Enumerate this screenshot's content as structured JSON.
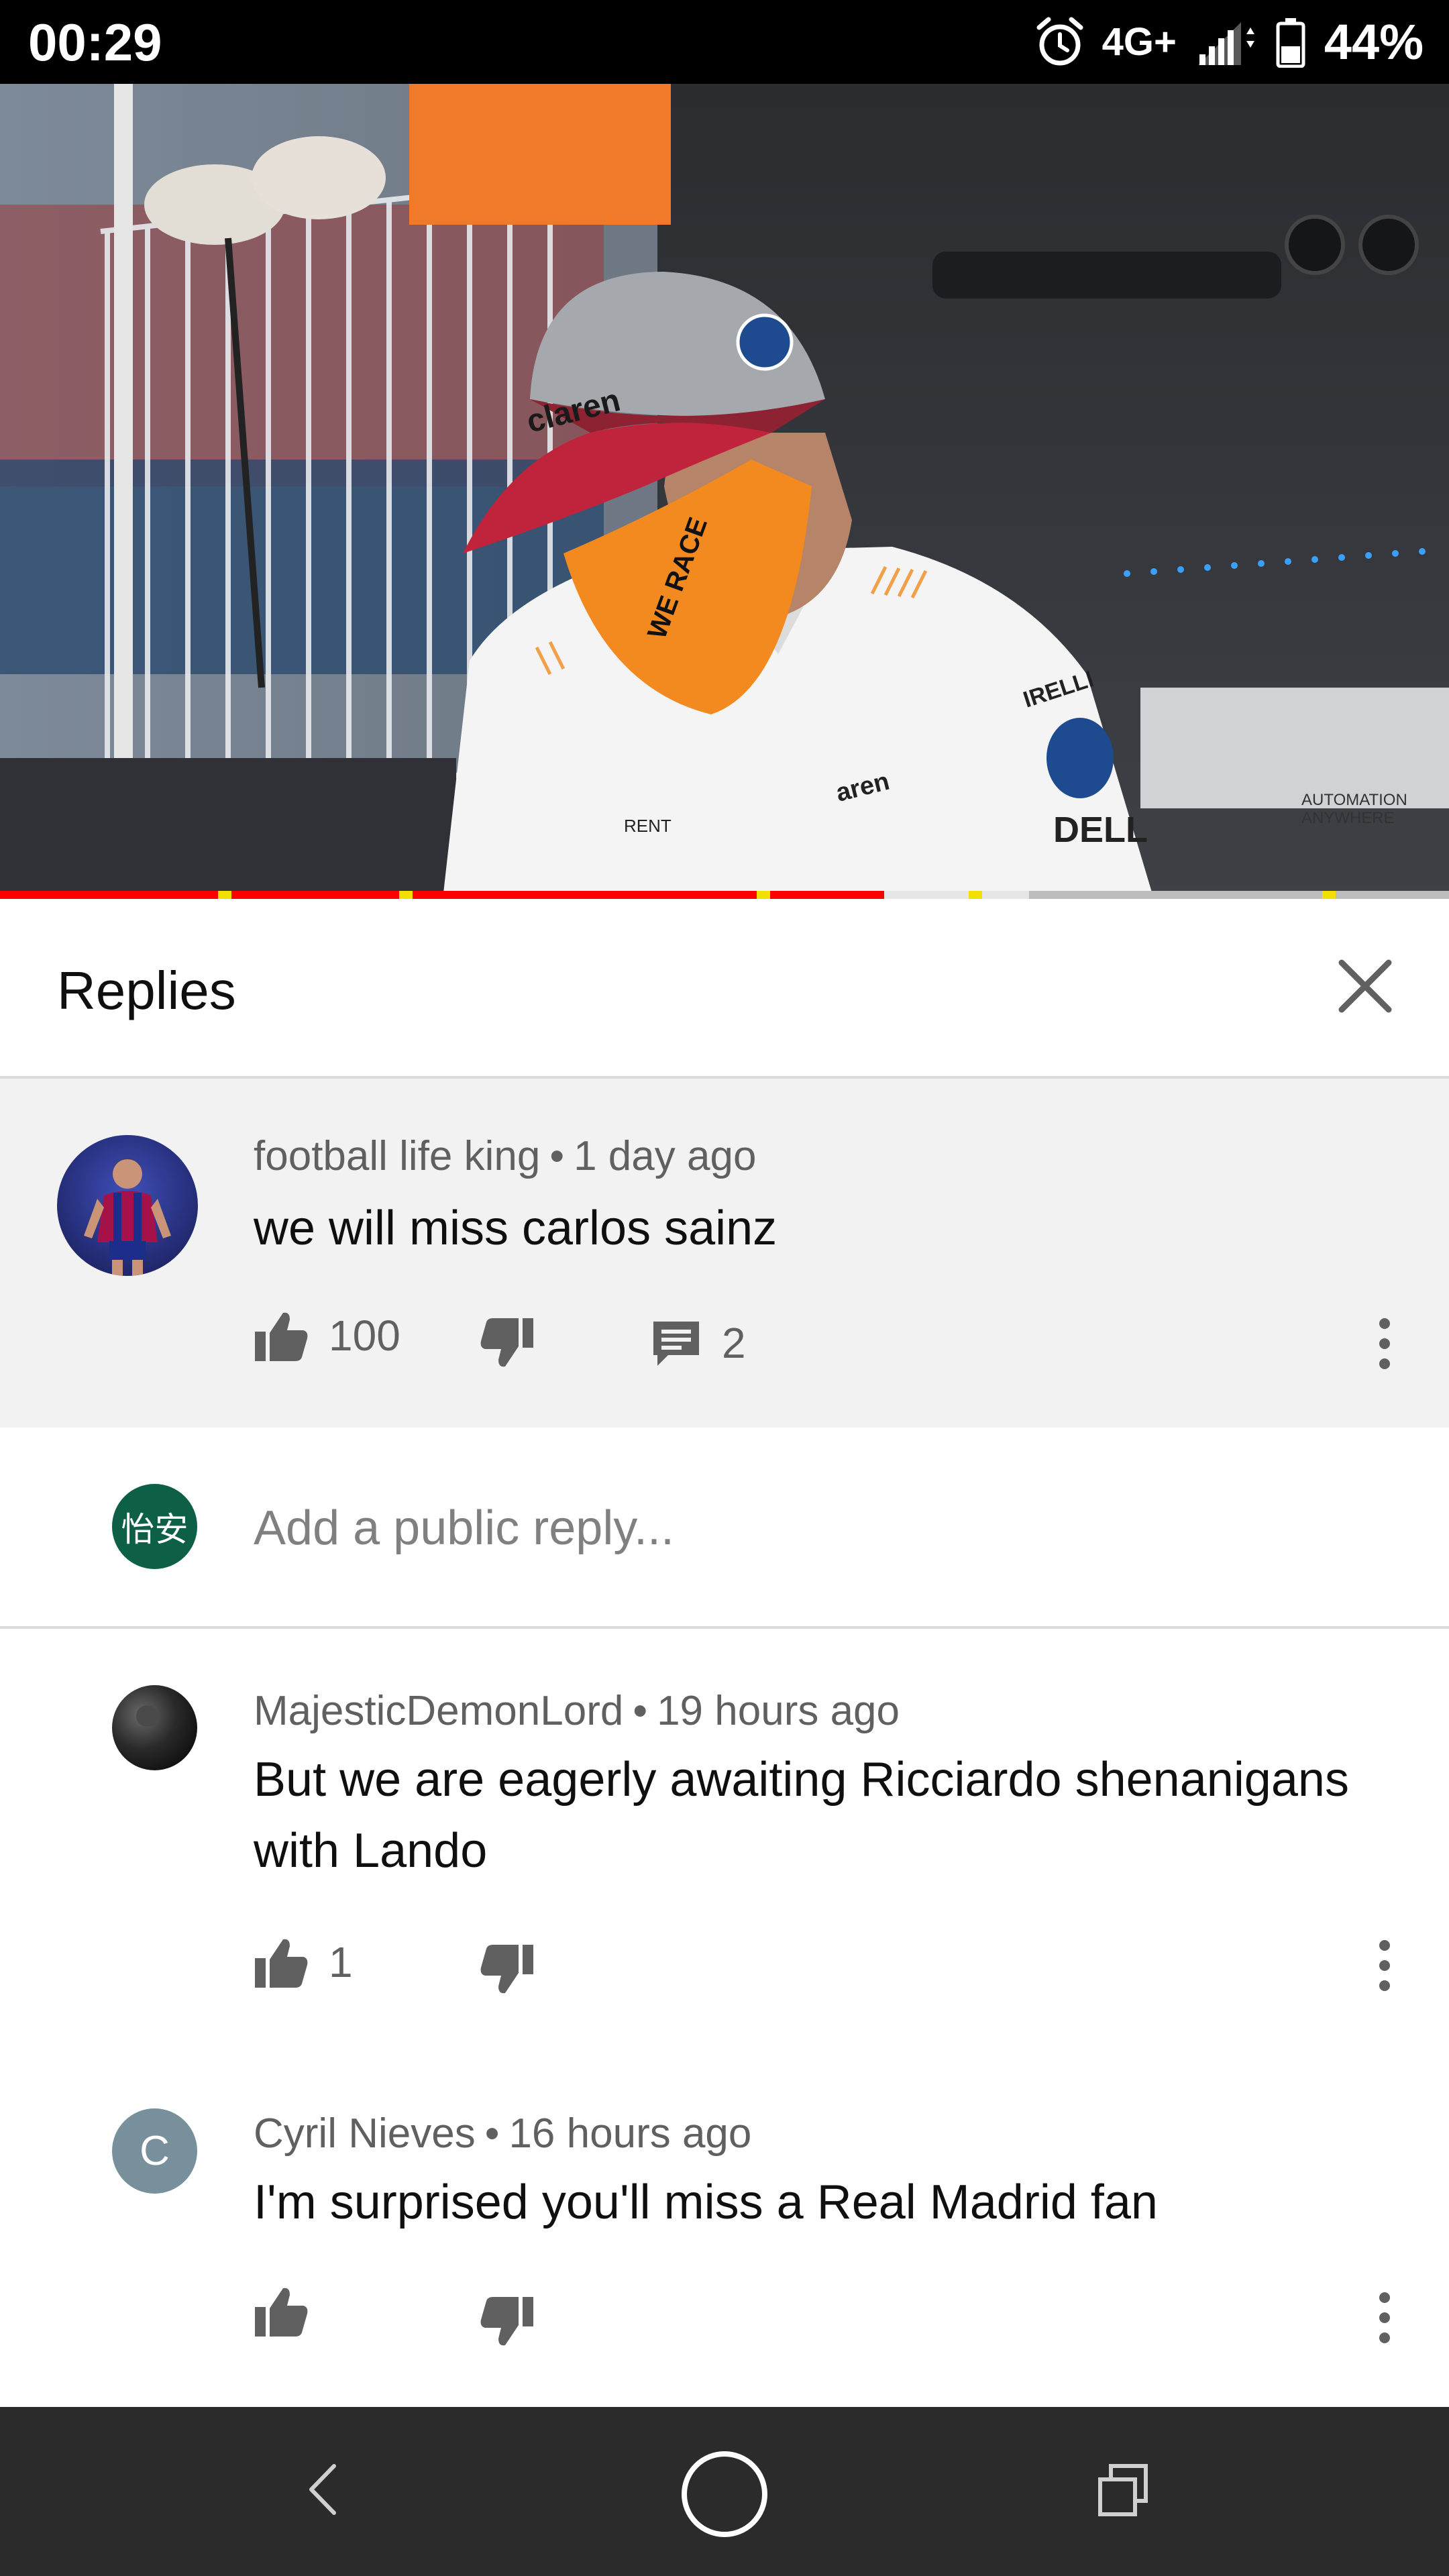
{
  "status_bar": {
    "time": "00:29",
    "network": "4G+",
    "battery": "44%",
    "icons": [
      "alarm-icon",
      "signal-icon",
      "battery-icon"
    ]
  },
  "video": {
    "progress_played_fraction": 0.61,
    "progress_buffered_fraction": 0.71,
    "chapter_markers_fraction": [
      0.155,
      0.28,
      0.527,
      0.673,
      0.917
    ]
  },
  "panel": {
    "title": "Replies",
    "close_icon": "close-icon"
  },
  "parent_comment": {
    "author": "football life king",
    "time": "1 day ago",
    "text": "we will miss carlos sainz",
    "likes": "100",
    "replies": "2"
  },
  "reply_box": {
    "user_initials": "怡安",
    "placeholder": "Add a public reply..."
  },
  "replies": [
    {
      "author": "MajesticDemonLord",
      "time": "19 hours ago",
      "text": "But we are eagerly awaiting Ricciardo shenanigans with Lando",
      "likes": "1"
    },
    {
      "author": "Cyril Nieves",
      "time": "16 hours ago",
      "text": "I'm surprised you'll miss a Real Madrid fan",
      "likes": "",
      "avatar_letter": "C"
    }
  ],
  "colors": {
    "accent_red": "#ff0000",
    "chapter_yellow": "#f2e000",
    "comment_bg": "#f2f2f2",
    "meta_gray": "#606060",
    "nav_bg": "#2b2b2b"
  }
}
